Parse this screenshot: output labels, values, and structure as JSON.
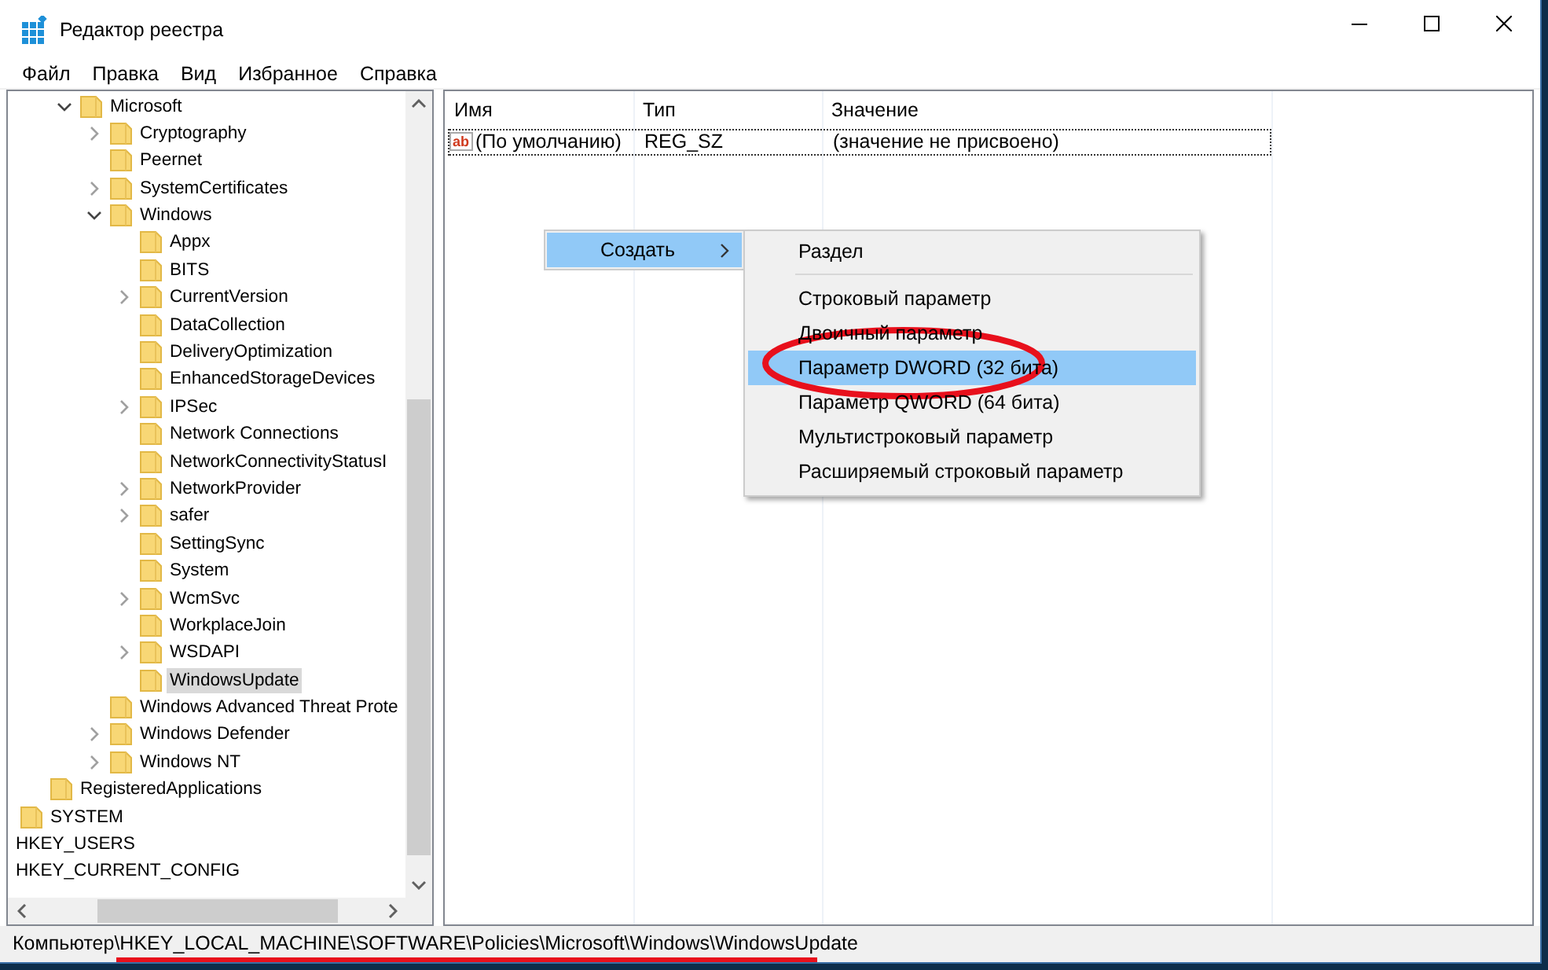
{
  "window": {
    "title": "Редактор реестра",
    "controls": [
      {
        "kind": "minimize"
      },
      {
        "kind": "maximize"
      },
      {
        "kind": "close"
      }
    ]
  },
  "menu": [
    "Файл",
    "Правка",
    "Вид",
    "Избранное",
    "Справка"
  ],
  "tree": [
    {
      "children": [
        {
          "children": [
            {
              "children": [
                {
                  "label": "Microsoft",
                  "kind": "folder",
                  "expanded": true,
                  "selected": false,
                  "children": [
                    {
                      "label": "Cryptography",
                      "kind": "folder",
                      "expanded": false,
                      "selected": false
                    },
                    {
                      "label": "Peernet",
                      "kind": "folder",
                      "selected": false
                    },
                    {
                      "label": "SystemCertificates",
                      "kind": "folder",
                      "expanded": false,
                      "selected": false
                    },
                    {
                      "label": "Windows",
                      "kind": "folder",
                      "expanded": true,
                      "selected": false,
                      "children": [
                        {
                          "label": "Appx",
                          "kind": "folder",
                          "selected": false
                        },
                        {
                          "label": "BITS",
                          "kind": "folder",
                          "selected": false
                        },
                        {
                          "label": "CurrentVersion",
                          "kind": "folder",
                          "expanded": false,
                          "selected": false
                        },
                        {
                          "label": "DataCollection",
                          "kind": "folder",
                          "selected": false
                        },
                        {
                          "label": "DeliveryOptimization",
                          "kind": "folder",
                          "selected": false
                        },
                        {
                          "label": "EnhancedStorageDevices",
                          "kind": "folder",
                          "selected": false
                        },
                        {
                          "label": "IPSec",
                          "kind": "folder",
                          "expanded": false,
                          "selected": false
                        },
                        {
                          "label": "Network Connections",
                          "kind": "folder",
                          "selected": false
                        },
                        {
                          "label": "NetworkConnectivityStatusI",
                          "kind": "folder",
                          "selected": false
                        },
                        {
                          "label": "NetworkProvider",
                          "kind": "folder",
                          "expanded": false,
                          "selected": false
                        },
                        {
                          "label": "safer",
                          "kind": "folder",
                          "expanded": false,
                          "selected": false
                        },
                        {
                          "label": "SettingSync",
                          "kind": "folder",
                          "selected": false
                        },
                        {
                          "label": "System",
                          "kind": "folder",
                          "selected": false
                        },
                        {
                          "label": "WcmSvc",
                          "kind": "folder",
                          "expanded": false,
                          "selected": false
                        },
                        {
                          "label": "WorkplaceJoin",
                          "kind": "folder",
                          "selected": false
                        },
                        {
                          "label": "WSDAPI",
                          "kind": "folder",
                          "expanded": false,
                          "selected": false
                        },
                        {
                          "label": "WindowsUpdate",
                          "kind": "folder",
                          "selected": true
                        }
                      ]
                    },
                    {
                      "label": "Windows Advanced Threat Prote",
                      "kind": "folder",
                      "selected": false
                    },
                    {
                      "label": "Windows Defender",
                      "kind": "folder",
                      "expanded": false,
                      "selected": false
                    },
                    {
                      "label": "Windows NT",
                      "kind": "folder",
                      "expanded": false,
                      "selected": false
                    }
                  ]
                }
              ]
            },
            {
              "label": "RegisteredApplications",
              "kind": "folder",
              "selected": false
            }
          ]
        },
        {
          "label": "SYSTEM",
          "kind": "folder",
          "selected": false
        }
      ]
    },
    {
      "label": "HKEY_USERS",
      "kind": "hive",
      "selected": false
    },
    {
      "label": "HKEY_CURRENT_CONFIG",
      "kind": "hive",
      "selected": false
    }
  ],
  "values_table": {
    "columns": [
      "Имя",
      "Тип",
      "Значение"
    ],
    "rows": [
      {
        "icon_text": "ab",
        "name": "(По умолчанию)",
        "type": "REG_SZ",
        "value": "(значение не присвоено)",
        "focused": true
      }
    ]
  },
  "context_menu": {
    "items": [
      {
        "label": "Создать",
        "selected": true,
        "submenu": true
      }
    ]
  },
  "submenu": {
    "items": [
      {
        "kind": "item",
        "label": "Раздел",
        "selected": false
      },
      {
        "kind": "separator"
      },
      {
        "kind": "item",
        "label": "Строковый параметр",
        "selected": false
      },
      {
        "kind": "item",
        "label": "Двоичный параметр",
        "selected": false
      },
      {
        "kind": "item",
        "label": "Параметр DWORD (32 бита)",
        "selected": true
      },
      {
        "kind": "item",
        "label": "Параметр QWORD (64 бита)",
        "selected": false
      },
      {
        "kind": "item",
        "label": "Мультистроковый параметр",
        "selected": false
      },
      {
        "kind": "item",
        "label": "Расширяемый строковый параметр",
        "selected": false
      }
    ]
  },
  "status_bar": {
    "path": "Компьютер\\HKEY_LOCAL_MACHINE\\SOFTWARE\\Policies\\Microsoft\\Windows\\WindowsUpdate"
  },
  "annotations": {
    "ellipse": true,
    "underline": true
  }
}
